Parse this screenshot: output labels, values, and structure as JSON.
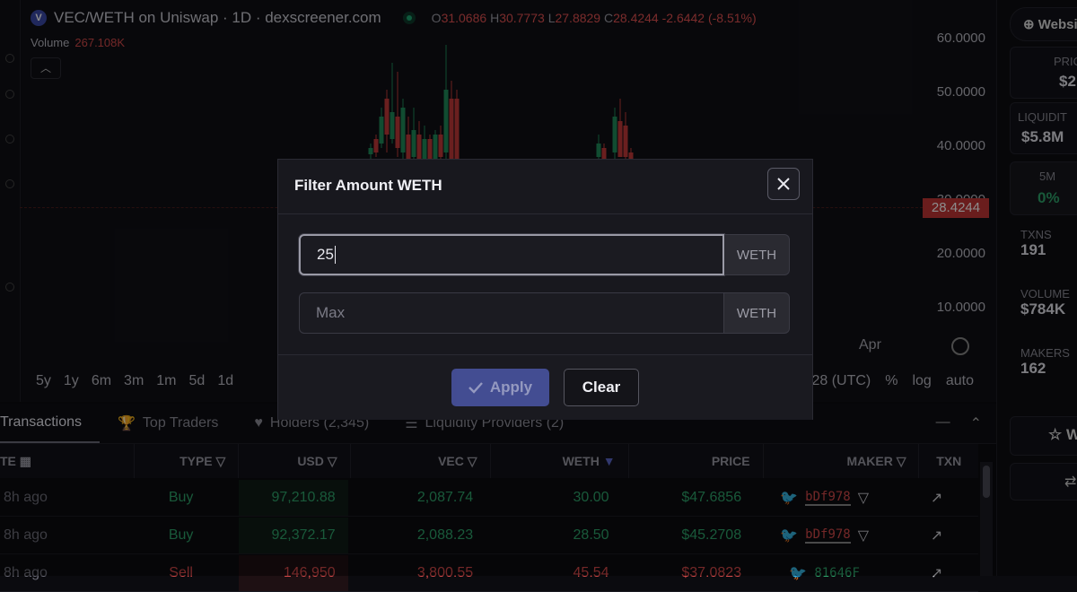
{
  "header": {
    "token_logo": "V",
    "title": "VEC/WETH on Uniswap · 1D · dexscreener.com",
    "ohlc": [
      {
        "label": "O",
        "value": "31.0686"
      },
      {
        "label": "H",
        "value": "30.7773"
      },
      {
        "label": "L",
        "value": "27.8829"
      },
      {
        "label": "C",
        "value": "28.4244"
      }
    ],
    "change": "-2.6442 (-8.51%)",
    "volume_label": "Volume",
    "volume_value": "267.108K",
    "collapse_icon": "chevron-up-icon"
  },
  "price_axis": [
    "60.0000",
    "50.0000",
    "40.0000",
    "30.0000",
    "20.0000",
    "10.0000"
  ],
  "current_price": "28.4244",
  "time_label": "Apr",
  "timeframes": [
    "5y",
    "1y",
    "6m",
    "3m",
    "1m",
    "5d",
    "1d"
  ],
  "time_right": ":28 (UTC)",
  "scale_options": [
    "%",
    "log",
    "auto"
  ],
  "tabs": [
    {
      "label": "Transactions",
      "active": true
    },
    {
      "label": "Top Traders",
      "icon": "trophy-icon"
    },
    {
      "label": "Holders (2,345)",
      "icon": "heart-icon"
    },
    {
      "label": "Liquidity Providers (2)",
      "icon": "list-icon"
    }
  ],
  "table": {
    "headers": [
      "TE",
      "TYPE",
      "USD",
      "VEC",
      "WETH",
      "PRICE",
      "MAKER",
      "TXN"
    ],
    "rows": [
      {
        "age": "8h ago",
        "type": "Buy",
        "usd": "97,210.88",
        "vec": "2,087.74",
        "weth": "30.00",
        "price": "$47.6856",
        "maker": "bDf978"
      },
      {
        "age": "8h ago",
        "type": "Buy",
        "usd": "92,372.17",
        "vec": "2,088.23",
        "weth": "28.50",
        "price": "$45.2708",
        "maker": "bDf978"
      },
      {
        "age": "8h ago",
        "type": "Sell",
        "usd": "146,950",
        "vec": "3,800.55",
        "weth": "45.54",
        "price": "$37.0823",
        "maker": "81646F"
      }
    ]
  },
  "right_panel": {
    "website_label": "Websi",
    "price_label": "PRIC",
    "price_value": "$2",
    "liquidity_label": "LIQUIDIT",
    "liquidity_value": "$5.8M",
    "period_label": "5M",
    "period_value": "0%",
    "txns_label": "TXNS",
    "txns_value": "191",
    "volume_label": "VOLUME",
    "volume_value": "$784K",
    "makers_label": "MAKERS",
    "makers_value": "162",
    "watchlist_label": "W"
  },
  "modal": {
    "title": "Filter Amount WETH",
    "min_value": "25",
    "min_unit": "WETH",
    "max_placeholder": "Max",
    "max_unit": "WETH",
    "apply_label": "Apply",
    "clear_label": "Clear"
  },
  "colors": {
    "buy": "#2ea36a",
    "sell": "#d44a4a",
    "apply_button": "#4b56a6",
    "price_tag": "#c23636"
  }
}
